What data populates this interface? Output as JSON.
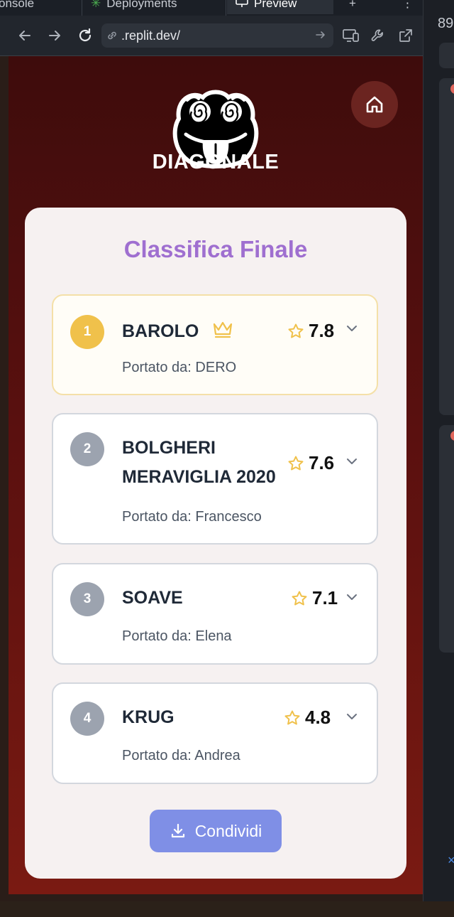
{
  "browser": {
    "tabs": [
      {
        "label": "onsole"
      },
      {
        "label": "Deployments"
      },
      {
        "label": "Preview"
      }
    ],
    "new_tab_label": "+",
    "more_label": "⋮",
    "url": ".replit.dev/",
    "right_panel_number": "89"
  },
  "app": {
    "logo_text": "DIAGONALE",
    "title": "Classifica Finale",
    "share_label": "Condividi",
    "accent_color": "#9f6fd0",
    "gold_color": "#f0c14b"
  },
  "ranking": [
    {
      "rank": "1",
      "name": "BAROLO",
      "score": "7.8",
      "brought_by_label": "Portato da: ",
      "brought_by": "DERO",
      "winner": true
    },
    {
      "rank": "2",
      "name_line1": "BOLGHERI",
      "name_line2": "MERAVIGLIA 2020",
      "score": "7.6",
      "brought_by_label": "Portato da: ",
      "brought_by": "Francesco"
    },
    {
      "rank": "3",
      "name": "SOAVE",
      "score": "7.1",
      "brought_by_label": "Portato da: ",
      "brought_by": "Elena"
    },
    {
      "rank": "4",
      "name": "KRUG",
      "score": "4.8",
      "brought_by_label": "Portato da: ",
      "brought_by": "Andrea"
    }
  ]
}
